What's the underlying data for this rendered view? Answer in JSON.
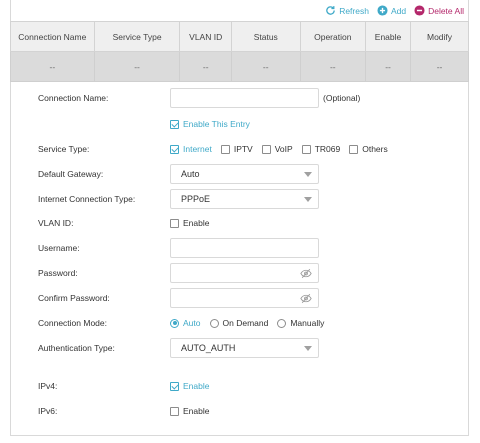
{
  "toolbar": {
    "refresh_label": "Refresh",
    "add_label": "Add",
    "delete_all_label": "Delete All"
  },
  "table": {
    "headers": [
      "Connection Name",
      "Service Type",
      "VLAN ID",
      "Status",
      "Operation",
      "Enable",
      "Modify"
    ],
    "row": [
      "--",
      "--",
      "--",
      "--",
      "--",
      "--",
      "--"
    ]
  },
  "form": {
    "connection_name": {
      "label": "Connection Name:",
      "value": "",
      "hint": "(Optional)"
    },
    "enable_entry": {
      "label": "Enable This Entry",
      "checked": true
    },
    "service_type": {
      "label": "Service Type:",
      "options": [
        {
          "label": "Internet",
          "checked": true
        },
        {
          "label": "IPTV",
          "checked": false
        },
        {
          "label": "VoIP",
          "checked": false
        },
        {
          "label": "TR069",
          "checked": false
        },
        {
          "label": "Others",
          "checked": false
        }
      ]
    },
    "default_gateway": {
      "label": "Default Gateway:",
      "value": "Auto"
    },
    "internet_connection_type": {
      "label": "Internet Connection Type:",
      "value": "PPPoE"
    },
    "vlan_id": {
      "label": "VLAN ID:",
      "option_label": "Enable",
      "checked": false
    },
    "username": {
      "label": "Username:",
      "value": ""
    },
    "password": {
      "label": "Password:",
      "value": ""
    },
    "confirm_password": {
      "label": "Confirm Password:",
      "value": ""
    },
    "connection_mode": {
      "label": "Connection Mode:",
      "options": [
        {
          "label": "Auto",
          "checked": true
        },
        {
          "label": "On Demand",
          "checked": false
        },
        {
          "label": "Manually",
          "checked": false
        }
      ]
    },
    "authentication_type": {
      "label": "Authentication Type:",
      "value": "AUTO_AUTH"
    },
    "ipv4": {
      "label": "IPv4:",
      "option_label": "Enable",
      "checked": true
    },
    "ipv6": {
      "label": "IPv6:",
      "option_label": "Enable",
      "checked": false
    }
  },
  "colors": {
    "accent": "#3fa9c8",
    "danger": "#b4286b",
    "table_header_bg": "#efefef",
    "table_row_bg": "#dbdbdb"
  }
}
